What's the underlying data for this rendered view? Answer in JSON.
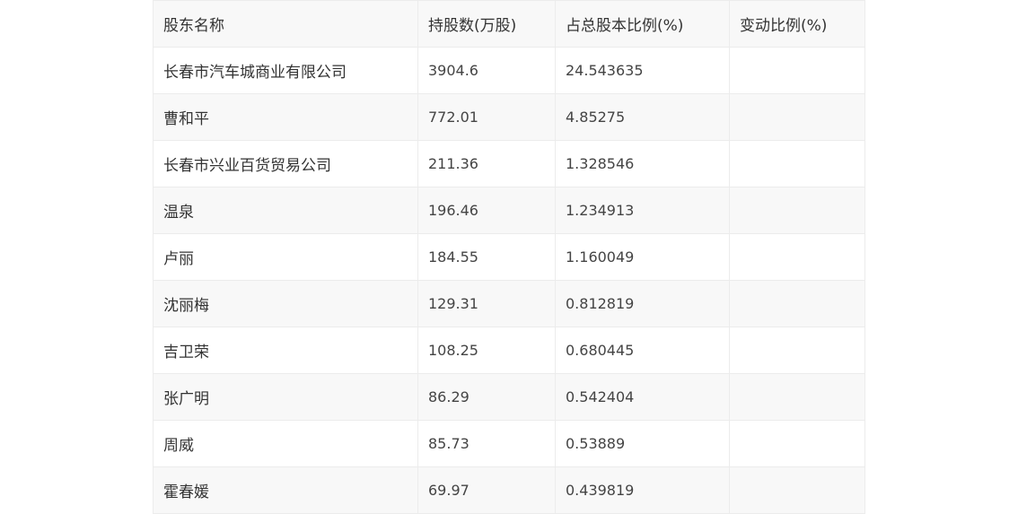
{
  "table": {
    "headers": [
      "股东名称",
      "持股数(万股)",
      "占总股本比例(%)",
      "变动比例(%)"
    ],
    "rows": [
      [
        "长春市汽车城商业有限公司",
        "3904.6",
        "24.543635",
        ""
      ],
      [
        "曹和平",
        "772.01",
        "4.85275",
        ""
      ],
      [
        "长春市兴业百货贸易公司",
        "211.36",
        "1.328546",
        ""
      ],
      [
        "温泉",
        "196.46",
        "1.234913",
        ""
      ],
      [
        "卢丽",
        "184.55",
        "1.160049",
        ""
      ],
      [
        "沈丽梅",
        "129.31",
        "0.812819",
        ""
      ],
      [
        "吉卫荣",
        "108.25",
        "0.680445",
        ""
      ],
      [
        "张广明",
        "86.29",
        "0.542404",
        ""
      ],
      [
        "周威",
        "85.73",
        "0.53889",
        ""
      ],
      [
        "霍春媛",
        "69.97",
        "0.439819",
        ""
      ]
    ]
  }
}
